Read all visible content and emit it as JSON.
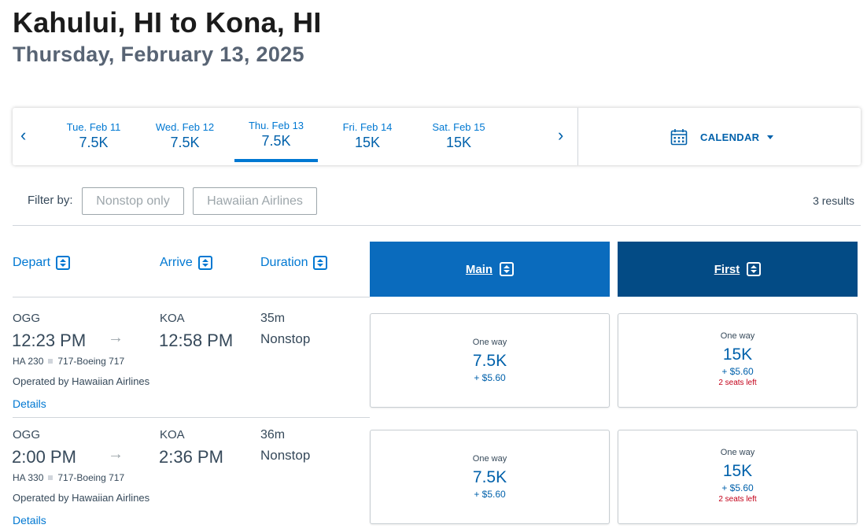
{
  "header": {
    "title": "Kahului, HI to Kona, HI",
    "date": "Thursday, February 13, 2025"
  },
  "datebar": {
    "prev_arrow": "‹",
    "next_arrow": "›",
    "days": [
      {
        "label": "Tue. Feb 11",
        "price": "7.5K",
        "selected": false
      },
      {
        "label": "Wed. Feb 12",
        "price": "7.5K",
        "selected": false
      },
      {
        "label": "Thu. Feb 13",
        "price": "7.5K",
        "selected": true
      },
      {
        "label": "Fri. Feb 14",
        "price": "15K",
        "selected": false
      },
      {
        "label": "Sat. Feb 15",
        "price": "15K",
        "selected": false
      }
    ],
    "calendar_label": "CALENDAR",
    "calendar_icon": "calendar-icon"
  },
  "filters": {
    "label": "Filter by:",
    "chips": [
      "Nonstop only",
      "Hawaiian Airlines"
    ],
    "results": "3 results"
  },
  "columns": {
    "depart": "Depart",
    "arrive": "Arrive",
    "duration": "Duration",
    "main": "Main",
    "first": "First"
  },
  "flights": [
    {
      "depart_code": "OGG",
      "depart_time": "12:23 PM",
      "arrive_code": "KOA",
      "arrive_time": "12:58 PM",
      "flight_no": "HA 230",
      "aircraft": "717-Boeing 717",
      "operated": "Operated by Hawaiian Airlines",
      "details": "Details",
      "duration": "35m",
      "stops": "Nonstop",
      "main": {
        "oneway": "One way",
        "price": "7.5K",
        "tax": "+ $5.60"
      },
      "first": {
        "oneway": "One way",
        "price": "15K",
        "tax": "+ $5.60",
        "seats": "2 seats left"
      }
    },
    {
      "depart_code": "OGG",
      "depart_time": "2:00 PM",
      "arrive_code": "KOA",
      "arrive_time": "2:36 PM",
      "flight_no": "HA 330",
      "aircraft": "717-Boeing 717",
      "operated": "Operated by Hawaiian Airlines",
      "details": "Details",
      "duration": "36m",
      "stops": "Nonstop",
      "main": {
        "oneway": "One way",
        "price": "7.5K",
        "tax": "+ $5.60"
      },
      "first": {
        "oneway": "One way",
        "price": "15K",
        "tax": "+ $5.60",
        "seats": "2 seats left"
      }
    }
  ],
  "colors": {
    "accent": "#0078d2",
    "main_header": "#0a6bbd",
    "first_header": "#034b85",
    "seats_warning": "#c30019"
  }
}
